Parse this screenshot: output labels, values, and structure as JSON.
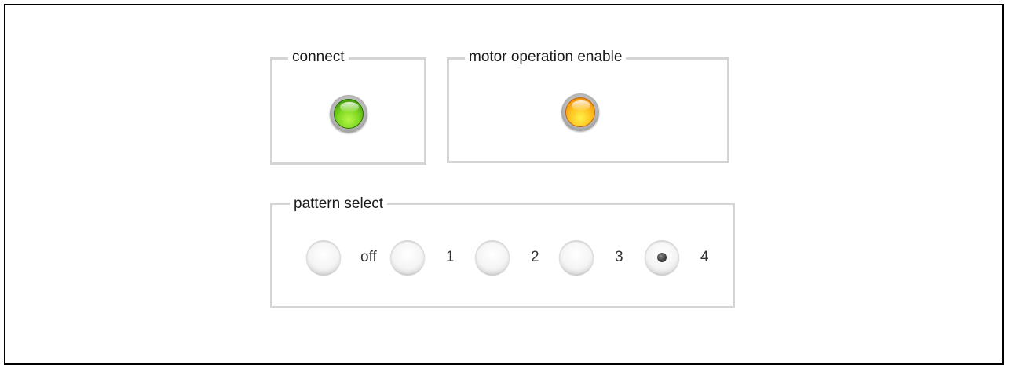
{
  "connect": {
    "legend": "connect",
    "indicator": {
      "state": "on",
      "color": "#7cd81e"
    }
  },
  "motor": {
    "legend": "motor operation enable",
    "indicator": {
      "state": "on",
      "color": "#ffc21f"
    }
  },
  "pattern": {
    "legend": "pattern select",
    "options": [
      {
        "label": "off",
        "selected": false
      },
      {
        "label": "1",
        "selected": false
      },
      {
        "label": "2",
        "selected": false
      },
      {
        "label": "3",
        "selected": false
      },
      {
        "label": "4",
        "selected": true
      }
    ],
    "selected": "4"
  }
}
